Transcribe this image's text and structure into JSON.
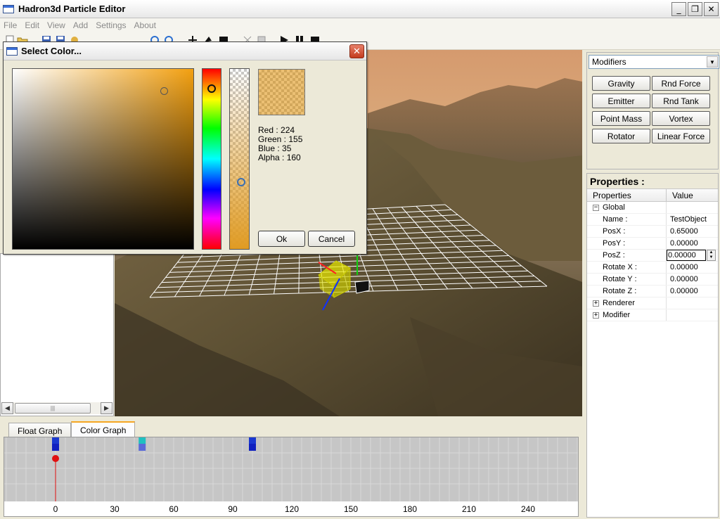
{
  "window": {
    "title": "Hadron3d Particle Editor",
    "minimize": "_",
    "maximize": "❐",
    "close": "✕"
  },
  "menu": [
    "File",
    "Edit",
    "View",
    "Add",
    "Settings",
    "About"
  ],
  "dialog": {
    "title": "Select Color...",
    "close": "✕",
    "red": "Red : 224",
    "green": "Green : 155",
    "blue": "Blue : 35",
    "alpha": "Alpha : 160",
    "ok": "Ok",
    "cancel": "Cancel",
    "color": "#e09b23"
  },
  "modifiers": {
    "selected": "Modifiers",
    "buttons": [
      "Gravity",
      "Rnd Force",
      "Emitter",
      "Rnd Tank",
      "Point Mass",
      "Vortex",
      "Rotator",
      "Linear Force"
    ]
  },
  "properties": {
    "title": "Properties :",
    "col_properties": "Properties",
    "col_value": "Value",
    "global": "Global",
    "name_key": "Name :",
    "name_val": "TestObject",
    "posx_key": "PosX :",
    "posx_val": "0.65000",
    "posy_key": "PosY :",
    "posy_val": "0.00000",
    "posz_key": "PosZ :",
    "posz_val": "0.00000",
    "rotx_key": "Rotate X :",
    "rotx_val": "0.00000",
    "roty_key": "Rotate Y :",
    "roty_val": "0.00000",
    "rotz_key": "Rotate Z :",
    "rotz_val": "0.00000",
    "renderer": "Renderer",
    "modifier": "Modifier"
  },
  "graph": {
    "tab_float": "Float Graph",
    "tab_color": "Color Graph",
    "ticks": [
      "0",
      "30",
      "60",
      "90",
      "120",
      "150",
      "180",
      "210",
      "240"
    ]
  }
}
